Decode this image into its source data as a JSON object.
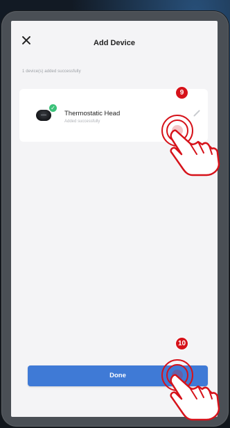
{
  "header": {
    "close_icon": "close-icon",
    "title": "Add Device"
  },
  "summary": "1 device(s) added successfully",
  "device": {
    "name": "Thermostatic Head",
    "status": "Added successfully",
    "badge_icon": "check-icon",
    "edit_icon": "pencil-icon"
  },
  "actions": {
    "done_label": "Done"
  },
  "annotations": {
    "step_9": "9",
    "step_10": "10",
    "hand_icon": "tap-hand-icon",
    "color": "#d6121a"
  },
  "colors": {
    "primary": "#3f7ad6",
    "success": "#3cc27a",
    "screen_bg": "#f4f4f6"
  }
}
